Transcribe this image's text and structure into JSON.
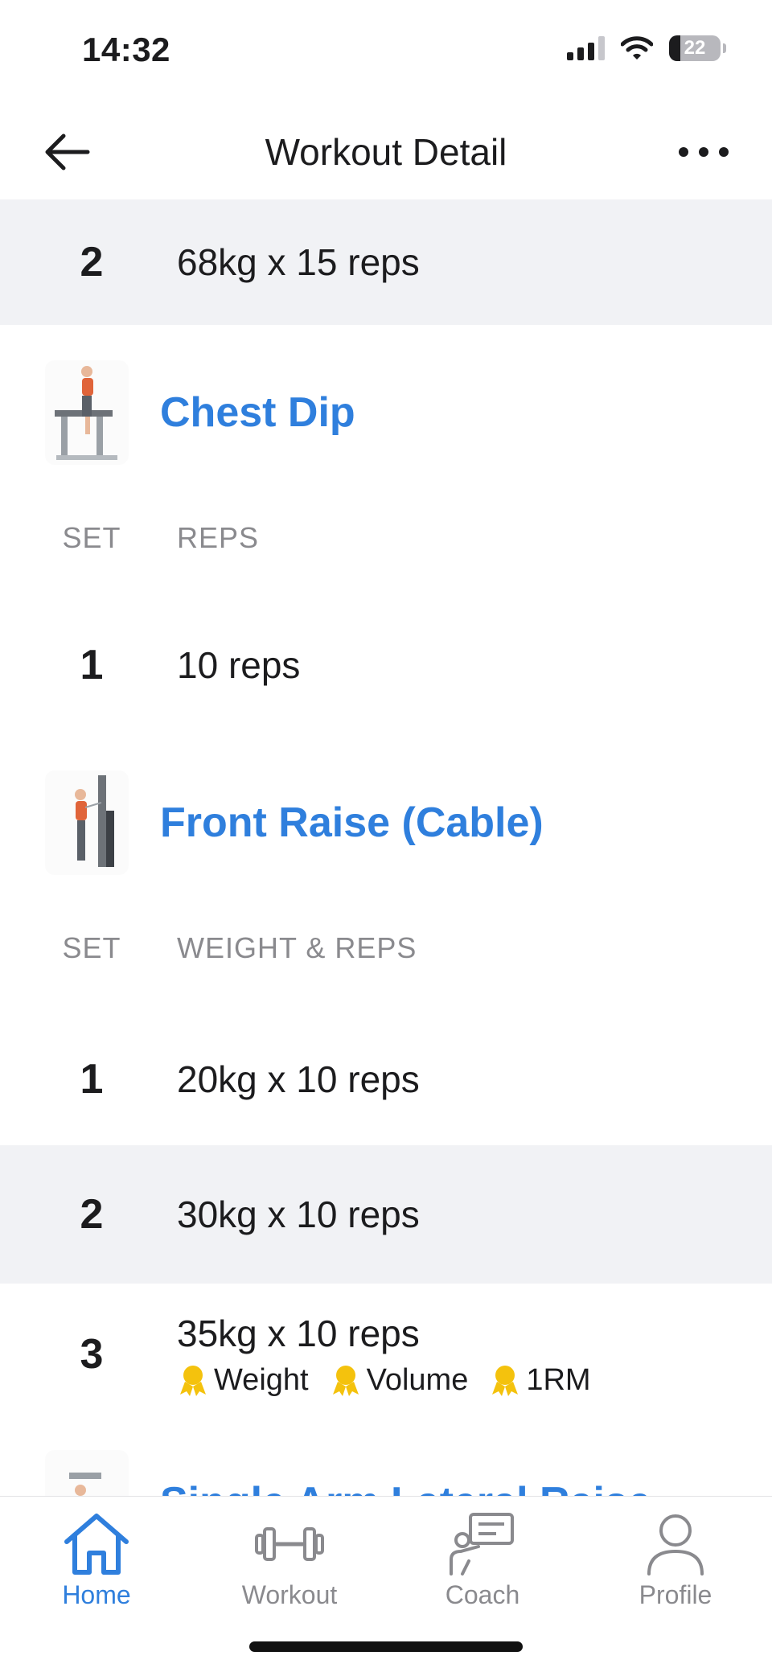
{
  "status_bar": {
    "time": "14:32",
    "battery": "22",
    "battery_level": 0.22
  },
  "nav": {
    "title": "Workout Detail"
  },
  "rows_top": [
    {
      "set": "2",
      "value": "68kg x 15 reps"
    }
  ],
  "exercises": [
    {
      "name": "Chest Dip",
      "columns": {
        "set": "SET",
        "value": "REPS"
      },
      "sets": [
        {
          "set": "1",
          "value": "10 reps"
        }
      ]
    },
    {
      "name": "Front Raise (Cable)",
      "columns": {
        "set": "SET",
        "value": "WEIGHT & REPS"
      },
      "sets": [
        {
          "set": "1",
          "value": "20kg x 10 reps"
        },
        {
          "set": "2",
          "value": "30kg x 10 reps"
        },
        {
          "set": "3",
          "value": "35kg x 10 reps",
          "badges": [
            "Weight",
            "Volume",
            "1RM"
          ]
        }
      ]
    },
    {
      "name": "Single Arm Lateral Raise"
    }
  ],
  "tabs": [
    {
      "label": "Home",
      "icon": "home-icon",
      "active": true
    },
    {
      "label": "Workout",
      "icon": "dumbbell-icon",
      "active": false
    },
    {
      "label": "Coach",
      "icon": "coach-icon",
      "active": false
    },
    {
      "label": "Profile",
      "icon": "profile-icon",
      "active": false
    }
  ],
  "colors": {
    "accent": "#2f7fdd",
    "row_alt": "#f1f2f5",
    "muted": "#8a8a8e",
    "medal": "#f4c20d"
  }
}
